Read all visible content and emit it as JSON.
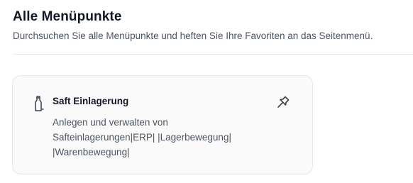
{
  "header": {
    "title": "Alle Menüpunkte",
    "subtitle": "Durchsuchen Sie alle Menüpunkte und heften Sie Ihre Favoriten an das Seitenmenü."
  },
  "menu_items": [
    {
      "icon": "bottle-icon",
      "title": "Saft Einlagerung",
      "description_lines": [
        "Anlegen und verwalten von",
        "Safteinlagerungen|ERP| |Lagerbewegung|",
        "|Warenbewegung|"
      ],
      "pin_icon": "pin-icon",
      "pinned": false
    }
  ],
  "colors": {
    "title": "#111827",
    "text_muted": "#4b5563",
    "card_background": "#fafafa",
    "card_border": "#e5e7eb",
    "icon": "#374151"
  }
}
